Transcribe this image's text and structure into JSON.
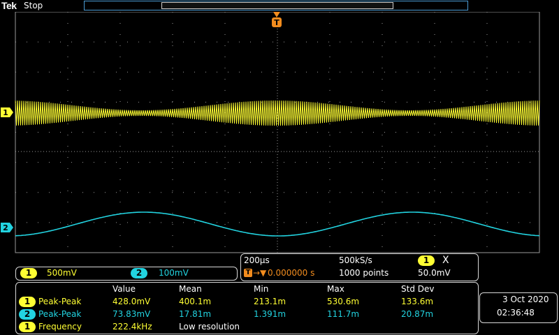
{
  "header": {
    "brand": "Tek",
    "acq_status": "Stop",
    "trigger_marker": "T"
  },
  "colors": {
    "ch1": "#ffff33",
    "ch2": "#22d3e0",
    "grid": "#9a9a9a",
    "panel_border": "#d8d8d8",
    "trigger": "#f28c1e"
  },
  "channels": [
    {
      "id": "1",
      "scale": "500mV"
    },
    {
      "id": "2",
      "scale": "100mV"
    }
  ],
  "timebase": {
    "scale": "200µs",
    "sample_rate": "500kS/s",
    "trigger_icon": "T",
    "position": "0.000000 s",
    "record_length": "1000 points",
    "trigger_source": "1",
    "trigger_slope": "X",
    "trigger_level": "50.0mV"
  },
  "measurements": {
    "headers": [
      "Value",
      "Mean",
      "Min",
      "Max",
      "Std Dev"
    ],
    "rows": [
      {
        "channel": "1",
        "name": "Peak-Peak",
        "value": "428.0mV",
        "mean": "400.1m",
        "min": "213.1m",
        "max": "530.6m",
        "stddev": "133.6m"
      },
      {
        "channel": "2",
        "name": "Peak-Peak",
        "value": "73.83mV",
        "mean": "17.81m",
        "min": "1.391m",
        "max": "111.7m",
        "stddev": "20.87m"
      },
      {
        "channel": "1",
        "name": "Frequency",
        "value": "222.4kHz",
        "note": "Low resolution"
      }
    ]
  },
  "datetime": {
    "date": "3 Oct  2020",
    "time": "02:36:48"
  }
}
